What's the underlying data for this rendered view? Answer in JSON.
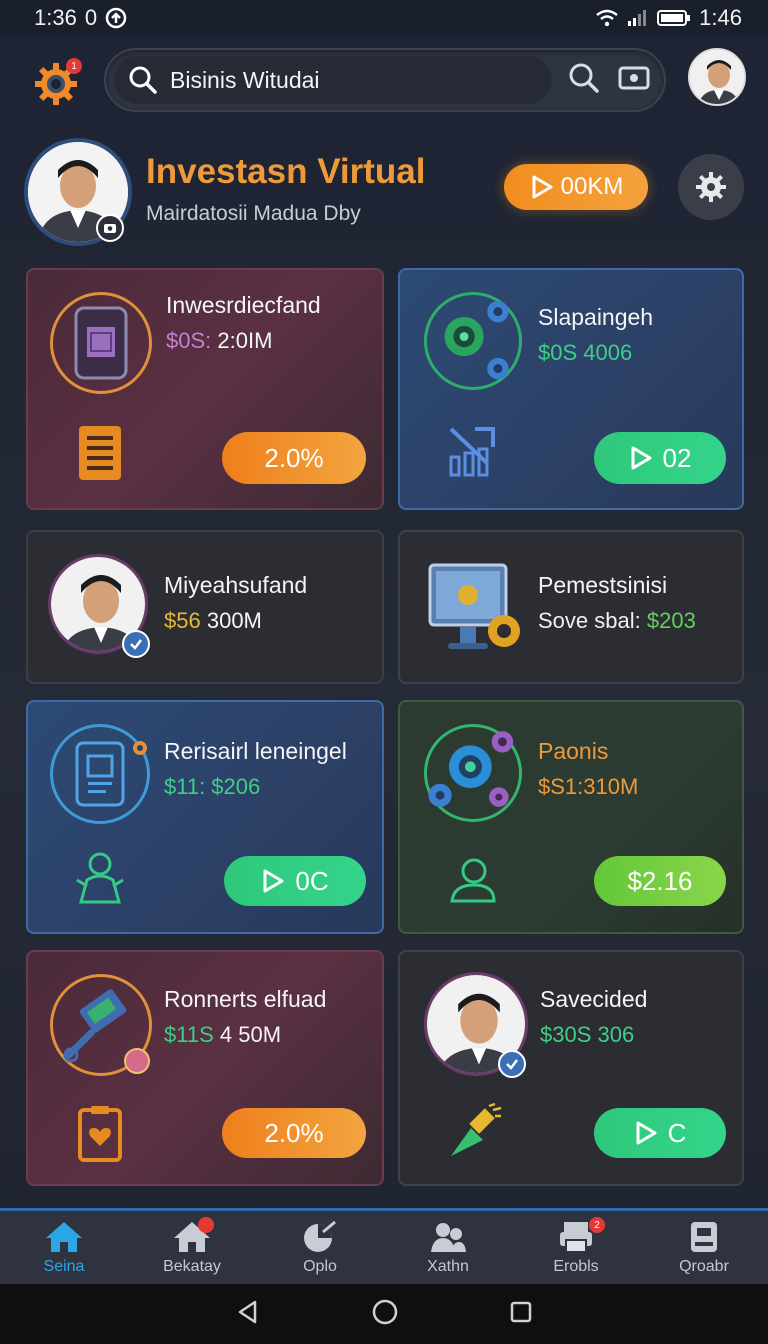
{
  "status": {
    "time": "1:36",
    "icons_left": "0",
    "time_right": "1:46"
  },
  "search": {
    "value": "Bisinis Witudai"
  },
  "profile": {
    "title": "Investasn Virtual",
    "subtitle": "Mairdatosii Madua Dby",
    "balance": "00KM"
  },
  "cards": [
    {
      "title": "Inwesrdiecfand",
      "value_prefix": "$0S:",
      "value_rest": "2:0IM",
      "pill": "2.0%"
    },
    {
      "title": "Slapaingeh",
      "value": "$0S 4006",
      "pill": "02"
    },
    {
      "title": "Miyeahsufand",
      "value_prefix": "$56",
      "value_rest": "300M"
    },
    {
      "title": "Pemestsinisi",
      "value_prefix": "Sove sbal:",
      "value_rest": "$203"
    },
    {
      "title": "Rerisairl leneingel",
      "value": "$11: $206",
      "pill": "0C"
    },
    {
      "title": "Paonis",
      "value": "$S1:310M",
      "pill": "$2.16"
    },
    {
      "title": "Ronnerts elfuad",
      "value_prefix": "$11S",
      "value_rest": "4 50M",
      "pill": "2.0%"
    },
    {
      "title": "Savecided",
      "value": "$30S 306",
      "pill": "C"
    }
  ],
  "nav": [
    {
      "label": "Seina",
      "icon": "home-icon",
      "active": true
    },
    {
      "label": "Bekatay",
      "icon": "store-icon",
      "badge": ""
    },
    {
      "label": "Oplo",
      "icon": "chart-icon"
    },
    {
      "label": "Xathn",
      "icon": "people-icon"
    },
    {
      "label": "Erobls",
      "icon": "printer-icon",
      "badge": "2"
    },
    {
      "label": "Qroabr",
      "icon": "profile-icon"
    }
  ],
  "colors": {
    "accent_orange": "#ef9a3a",
    "green": "#34d48a",
    "blue_active": "#2ba7e5"
  }
}
